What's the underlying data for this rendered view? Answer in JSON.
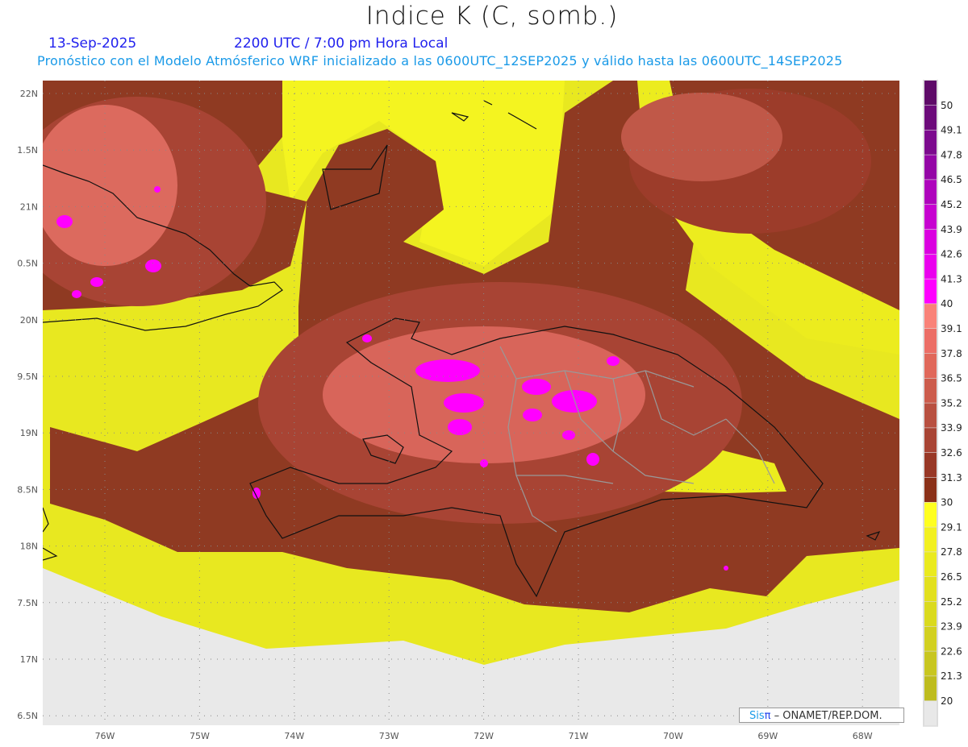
{
  "header": {
    "title": "Indice K (C, somb.)",
    "date": "13-Sep-2025",
    "time": "2200 UTC / 7:00 pm Hora Local",
    "description": "Pronóstico con el Modelo Atmósferico WRF inicializado a las 0600UTC_12SEP2025 y válido hasta las  0600UTC_14SEP2025"
  },
  "axes": {
    "lat_labels": [
      "22N",
      "1.5N",
      "21N",
      "0.5N",
      "20N",
      "9.5N",
      "19N",
      "8.5N",
      "18N",
      "7.5N",
      "17N",
      "6.5N"
    ],
    "lon_labels": [
      "76W",
      "75W",
      "74W",
      "73W",
      "72W",
      "71W",
      "70W",
      "69W",
      "68W"
    ]
  },
  "legend": {
    "labels": [
      "50",
      "49.1",
      "47.8",
      "46.5",
      "45.2",
      "43.9",
      "42.6",
      "41.3",
      "40",
      "39.1",
      "37.8",
      "36.5",
      "35.2",
      "33.9",
      "32.6",
      "31.3",
      "30",
      "29.1",
      "27.8",
      "26.5",
      "25.2",
      "23.9",
      "22.6",
      "21.3",
      "20"
    ],
    "colors": [
      "#5e0a68",
      "#6c0a7a",
      "#7c0a8e",
      "#9406a6",
      "#ae04bc",
      "#c602d0",
      "#da00e0",
      "#ea00ee",
      "#ff00ff",
      "#f98278",
      "#ec6e66",
      "#e0685a",
      "#cc5c4c",
      "#b85040",
      "#a84434",
      "#983826",
      "#8a3018",
      "#ffff20",
      "#f2f020",
      "#eaea1e",
      "#e2e01e",
      "#dada1e",
      "#d2d020",
      "#c8c620",
      "#bebc1e",
      "#e8e8e8"
    ]
  },
  "credit": {
    "brand_a": "Sis",
    "brand_b": "π",
    "text": "–  ONAMET/REP.DOM."
  },
  "colors": {
    "dark_brown": "#8a3018",
    "mid_brown": "#a84434",
    "salmon": "#e0685a",
    "magenta": "#ff00ff",
    "yellow": "#eeee1e",
    "missing": "#e8e8e8"
  }
}
